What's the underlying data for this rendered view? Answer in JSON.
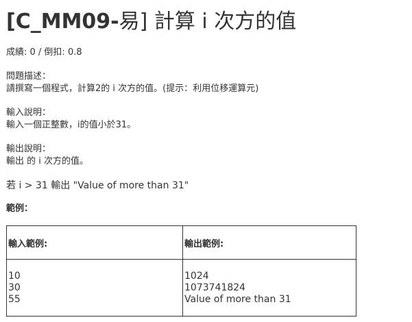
{
  "title": {
    "code": "[C_MM09-",
    "rest": "易] 計算 i 次方的值"
  },
  "score_line": "成績: 0 / 倒扣: 0.8",
  "description": {
    "label": "問題描述：",
    "text": "請撰寫一個程式，計算2的  i 次方的值。(提示：利用位移運算元)"
  },
  "input_desc": {
    "label": "輸入說明：",
    "text": "輸入一個正整數，i的值小於31。"
  },
  "output_desc": {
    "label": "輸出說明：",
    "text": "輸出 的 i 次方的值。"
  },
  "condition": "若 i > 31 輸出 \"Value of more than 31\"",
  "examples_label": "範例：",
  "examples_table": {
    "headers": [
      "輸入範例:",
      "輸出範例:"
    ],
    "input_lines": [
      "10",
      "30",
      "55"
    ],
    "output_lines": [
      "1024",
      "1073741824",
      "Value of more than 31"
    ]
  }
}
